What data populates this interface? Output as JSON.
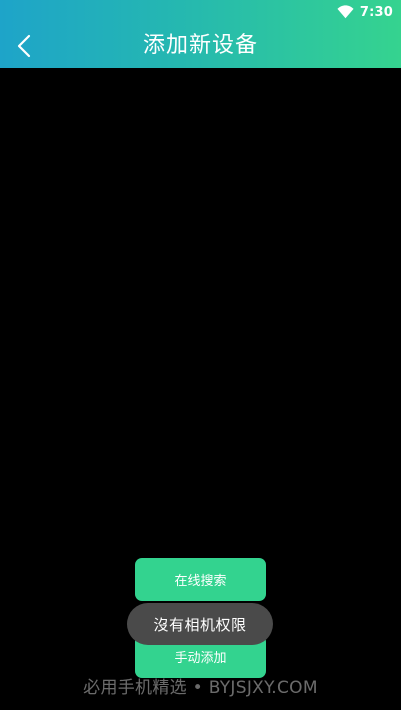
{
  "status_bar": {
    "time": "7:30",
    "wifi_icon": "wifi-icon"
  },
  "header": {
    "title": "添加新设备",
    "back_icon": "chevron-left-icon",
    "gradient_start": "#1ea4c9",
    "gradient_end": "#35d38f"
  },
  "actions": {
    "search_label": "在线搜索",
    "manual_label": "手动添加",
    "button_color": "#33d38f"
  },
  "toast": {
    "message": "沒有相机权限"
  },
  "watermark": {
    "text": "必用手机精选 • BYJSJXY.COM"
  }
}
